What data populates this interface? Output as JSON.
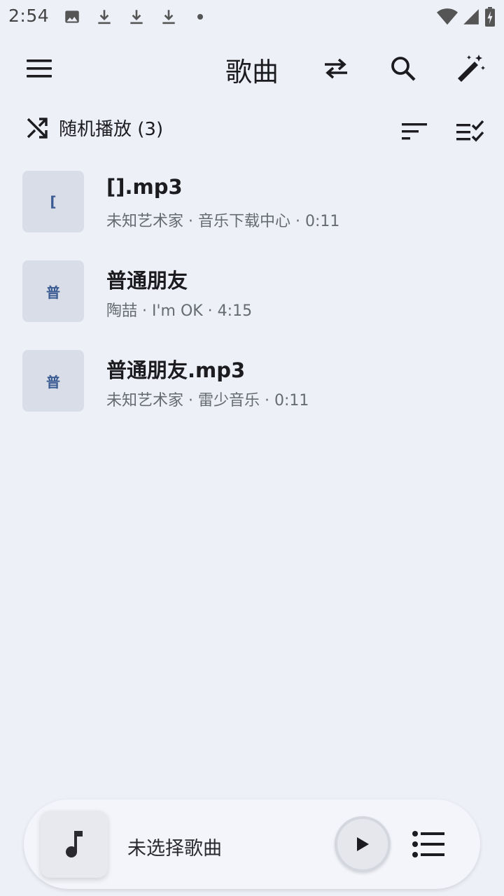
{
  "status_bar": {
    "time": "2:54",
    "left_icons": [
      "image-icon",
      "download-icon",
      "download-icon",
      "download-icon",
      "dot-icon"
    ],
    "right_icons": [
      "wifi-icon",
      "signal-icon",
      "battery-charging-icon"
    ]
  },
  "app_bar": {
    "title": "歌曲",
    "actions": [
      "menu-icon",
      "swap-icon",
      "search-icon",
      "magic-wand-icon"
    ]
  },
  "toolbar": {
    "shuffle_label": "随机播放 (3)",
    "actions": [
      "sort-icon",
      "checklist-icon"
    ]
  },
  "songs": [
    {
      "thumb": "[",
      "title": "[].mp3",
      "subtitle": "未知艺术家 · 音乐下载中心 · 0:11"
    },
    {
      "thumb": "普",
      "title": "普通朋友",
      "subtitle": "陶喆 · I'm OK · 4:15"
    },
    {
      "thumb": "普",
      "title": "普通朋友.mp3",
      "subtitle": "未知艺术家 · 雷少音乐 · 0:11"
    }
  ],
  "mini_player": {
    "title": "未选择歌曲",
    "icons": [
      "music-note-icon",
      "play-icon",
      "queue-icon"
    ]
  },
  "colors": {
    "background": "#eef0f7",
    "thumb_bg": "#d9dde8",
    "thumb_text": "#3b5b93",
    "subtitle": "#666a73"
  }
}
